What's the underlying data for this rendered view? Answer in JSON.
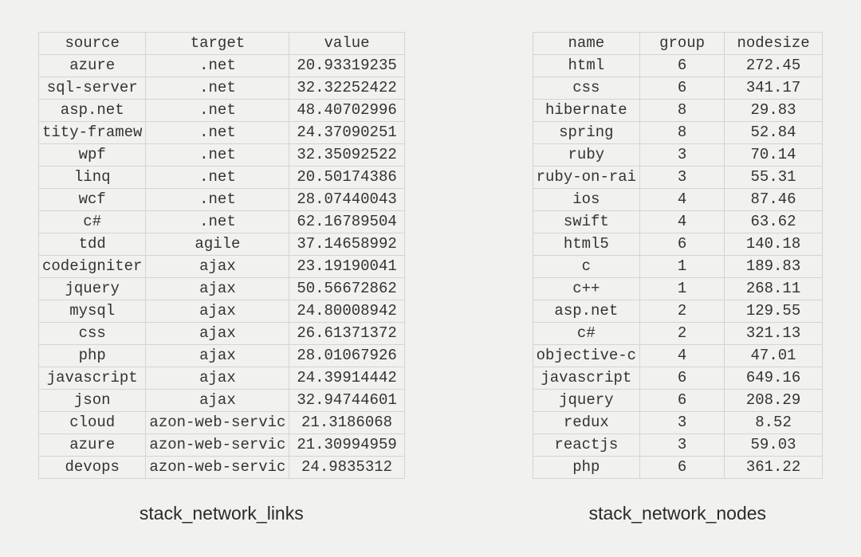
{
  "links": {
    "caption": "stack_network_links",
    "columns": [
      "source",
      "target",
      "value"
    ],
    "rows": [
      [
        "azure",
        ".net",
        "20.93319235"
      ],
      [
        "sql-server",
        ".net",
        "32.32252422"
      ],
      [
        "asp.net",
        ".net",
        "48.40702996"
      ],
      [
        "tity-framew",
        ".net",
        "24.37090251"
      ],
      [
        "wpf",
        ".net",
        "32.35092522"
      ],
      [
        "linq",
        ".net",
        "20.50174386"
      ],
      [
        "wcf",
        ".net",
        "28.07440043"
      ],
      [
        "c#",
        ".net",
        "62.16789504"
      ],
      [
        "tdd",
        "agile",
        "37.14658992"
      ],
      [
        "codeigniter",
        "ajax",
        "23.19190041"
      ],
      [
        "jquery",
        "ajax",
        "50.56672862"
      ],
      [
        "mysql",
        "ajax",
        "24.80008942"
      ],
      [
        "css",
        "ajax",
        "26.61371372"
      ],
      [
        "php",
        "ajax",
        "28.01067926"
      ],
      [
        "javascript",
        "ajax",
        "24.39914442"
      ],
      [
        "json",
        "ajax",
        "32.94744601"
      ],
      [
        "cloud",
        "azon-web-servic",
        "21.3186068"
      ],
      [
        "azure",
        "azon-web-servic",
        "21.30994959"
      ],
      [
        "devops",
        "azon-web-servic",
        "24.9835312"
      ]
    ]
  },
  "nodes": {
    "caption": "stack_network_nodes",
    "columns": [
      "name",
      "group",
      "nodesize"
    ],
    "rows": [
      [
        "html",
        "6",
        "272.45"
      ],
      [
        "css",
        "6",
        "341.17"
      ],
      [
        "hibernate",
        "8",
        "29.83"
      ],
      [
        "spring",
        "8",
        "52.84"
      ],
      [
        "ruby",
        "3",
        "70.14"
      ],
      [
        "ruby-on-rai",
        "3",
        "55.31"
      ],
      [
        "ios",
        "4",
        "87.46"
      ],
      [
        "swift",
        "4",
        "63.62"
      ],
      [
        "html5",
        "6",
        "140.18"
      ],
      [
        "c",
        "1",
        "189.83"
      ],
      [
        "c++",
        "1",
        "268.11"
      ],
      [
        "asp.net",
        "2",
        "129.55"
      ],
      [
        "c#",
        "2",
        "321.13"
      ],
      [
        "objective-c",
        "4",
        "47.01"
      ],
      [
        "javascript",
        "6",
        "649.16"
      ],
      [
        "jquery",
        "6",
        "208.29"
      ],
      [
        "redux",
        "3",
        "8.52"
      ],
      [
        "reactjs",
        "3",
        "59.03"
      ],
      [
        "php",
        "6",
        "361.22"
      ]
    ]
  }
}
